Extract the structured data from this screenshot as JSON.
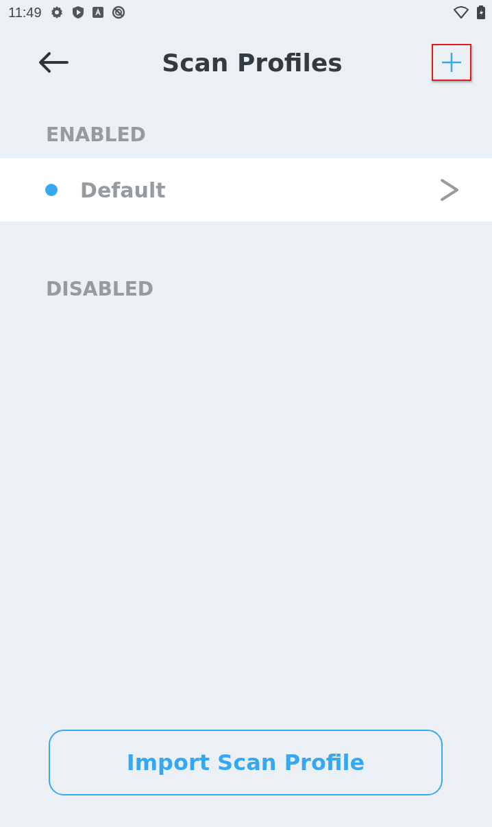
{
  "status_bar": {
    "time": "11:49"
  },
  "header": {
    "title": "Scan Profiles",
    "add_highlighted": true
  },
  "sections": [
    {
      "title": "ENABLED",
      "items": [
        {
          "name": "Default",
          "color": "#35a8f0"
        }
      ]
    },
    {
      "title": "DISABLED"
    }
  ],
  "import_button": "Import Scan Profile"
}
